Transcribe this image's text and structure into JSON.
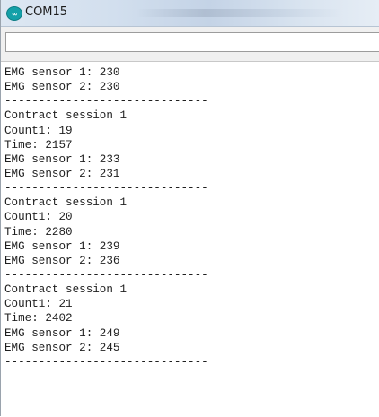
{
  "window": {
    "title": "COM15",
    "icon": "arduino-logo-icon",
    "accent": "#14a0a8"
  },
  "send": {
    "value": ""
  },
  "output": {
    "lines": [
      "EMG sensor 1: 230",
      "EMG sensor 2: 230",
      "------------------------------",
      "Contract session 1",
      "Count1: 19",
      "Time: 2157",
      "EMG sensor 1: 233",
      "EMG sensor 2: 231",
      "------------------------------",
      "Contract session 1",
      "Count1: 20",
      "Time: 2280",
      "EMG sensor 1: 239",
      "EMG sensor 2: 236",
      "------------------------------",
      "Contract session 1",
      "Count1: 21",
      "Time: 2402",
      "EMG sensor 1: 249",
      "EMG sensor 2: 245",
      "------------------------------"
    ]
  }
}
